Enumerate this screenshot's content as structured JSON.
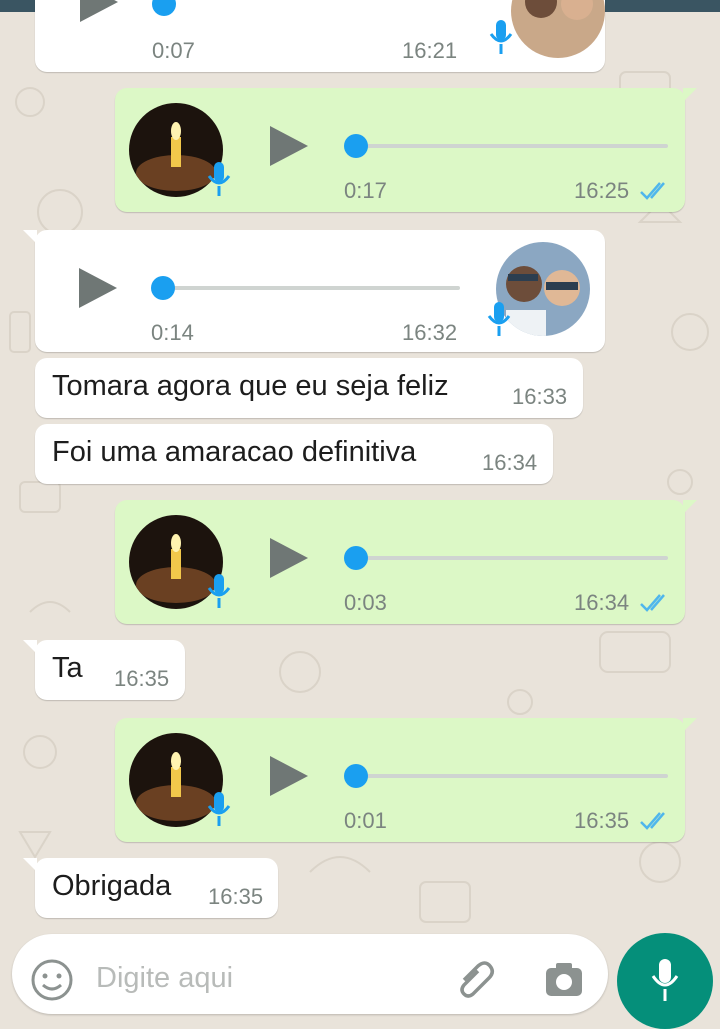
{
  "messages": [
    {
      "type": "audio",
      "direction": "in",
      "duration": "0:07",
      "time": "16:21"
    },
    {
      "type": "audio",
      "direction": "out",
      "duration": "0:17",
      "time": "16:25",
      "status": "read"
    },
    {
      "type": "audio",
      "direction": "in",
      "duration": "0:14",
      "time": "16:32"
    },
    {
      "type": "text",
      "direction": "in",
      "text": "Tomara agora que eu seja feliz",
      "time": "16:33"
    },
    {
      "type": "text",
      "direction": "in",
      "text": "Foi uma amaracao definitiva",
      "time": "16:34"
    },
    {
      "type": "audio",
      "direction": "out",
      "duration": "0:03",
      "time": "16:34",
      "status": "read"
    },
    {
      "type": "text",
      "direction": "in",
      "text": "Ta",
      "time": "16:35"
    },
    {
      "type": "audio",
      "direction": "out",
      "duration": "0:01",
      "time": "16:35",
      "status": "read"
    },
    {
      "type": "text",
      "direction": "in",
      "text": "Obrigada",
      "time": "16:35"
    }
  ],
  "composer": {
    "placeholder": "Digite aqui",
    "icons": [
      "emoji-icon",
      "attach-icon",
      "camera-icon",
      "mic-icon"
    ]
  },
  "colors": {
    "outgoing_bubble": "#dcf8c6",
    "incoming_bubble": "#ffffff",
    "audio_knob": "#1a9ff0",
    "read_ticks": "#4fb6ec",
    "fab": "#058f7a"
  }
}
